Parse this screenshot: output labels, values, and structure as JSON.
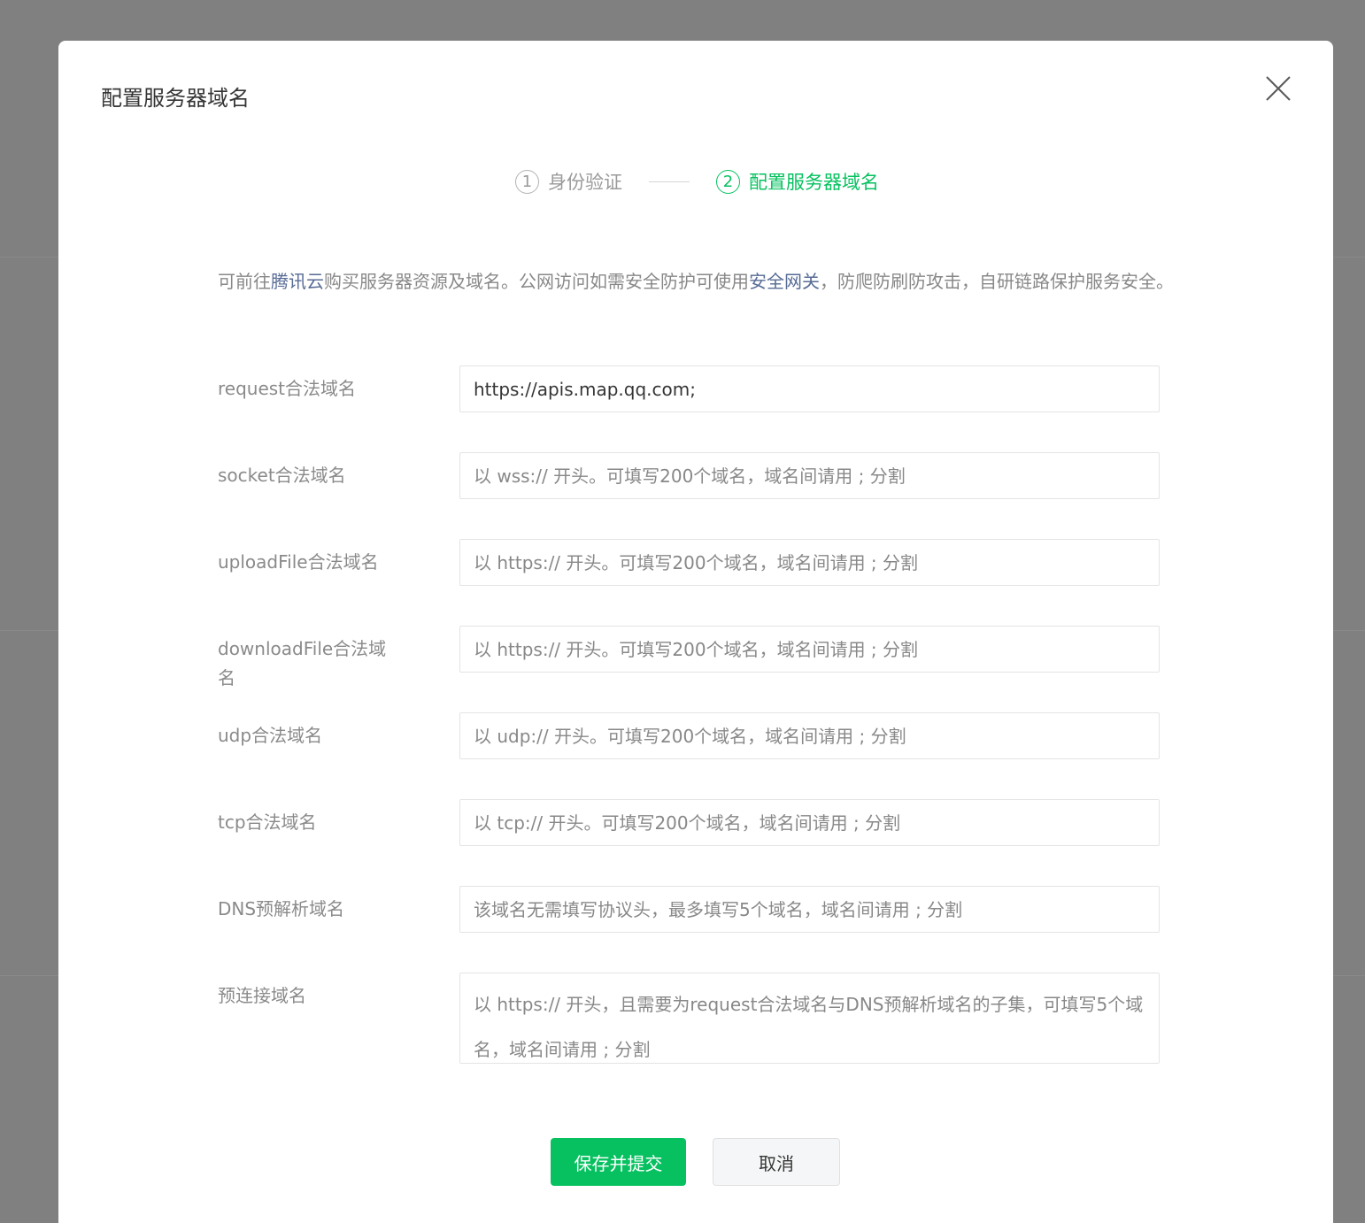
{
  "modal": {
    "title": "配置服务器域名",
    "close_icon": "close-icon"
  },
  "steps": [
    {
      "num": "1",
      "label": "身份验证",
      "state": "inactive"
    },
    {
      "num": "2",
      "label": "配置服务器域名",
      "state": "active"
    }
  ],
  "intro": {
    "prefix": "可前往",
    "link1": "腾讯云",
    "middle": "购买服务器资源及域名。公网访问如需安全防护可使用",
    "link2": "安全网关",
    "suffix": "，防爬防刷防攻击，自研链路保护服务安全。"
  },
  "fields": {
    "request": {
      "label": "request合法域名",
      "value": "https://apis.map.qq.com;",
      "placeholder": ""
    },
    "socket": {
      "label": "socket合法域名",
      "value": "",
      "placeholder": "以 wss:// 开头。可填写200个域名，域名间请用 ; 分割"
    },
    "uploadFile": {
      "label": "uploadFile合法域名",
      "value": "",
      "placeholder": "以 https:// 开头。可填写200个域名，域名间请用 ; 分割"
    },
    "downloadFile": {
      "label": "downloadFile合法域名",
      "value": "",
      "placeholder": "以 https:// 开头。可填写200个域名，域名间请用 ; 分割"
    },
    "udp": {
      "label": "udp合法域名",
      "value": "",
      "placeholder": "以 udp:// 开头。可填写200个域名，域名间请用 ; 分割"
    },
    "tcp": {
      "label": "tcp合法域名",
      "value": "",
      "placeholder": "以 tcp:// 开头。可填写200个域名，域名间请用 ; 分割"
    },
    "dns": {
      "label": "DNS预解析域名",
      "value": "",
      "placeholder": "该域名无需填写协议头，最多填写5个域名，域名间请用 ; 分割"
    },
    "preconnect": {
      "label": "预连接域名",
      "value": "",
      "placeholder": "以 https:// 开头，且需要为request合法域名与DNS预解析域名的子集，可填写5个域名，域名间请用 ; 分割"
    }
  },
  "buttons": {
    "submit": "保存并提交",
    "cancel": "取消"
  },
  "colors": {
    "accent": "#07c160",
    "link": "#576b95",
    "overlay": "#808080"
  }
}
